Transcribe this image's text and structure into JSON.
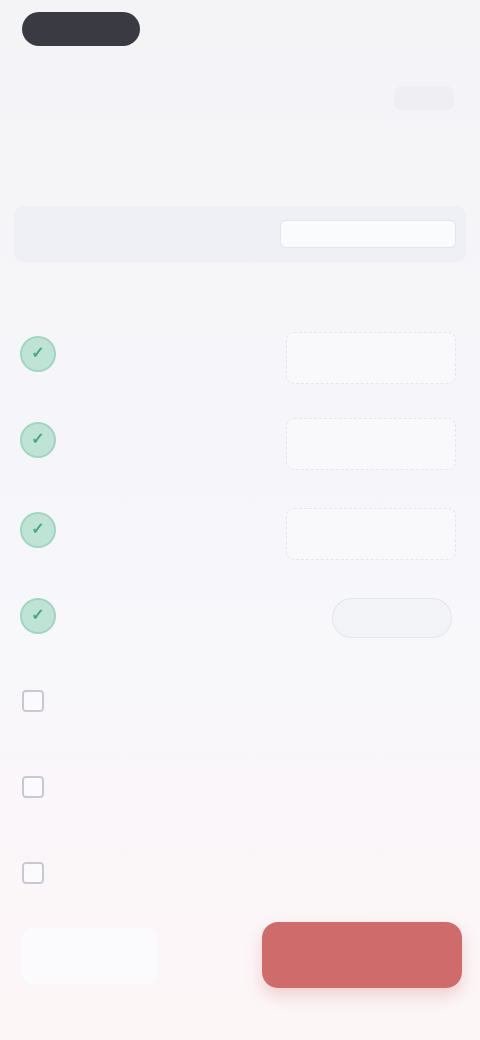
{
  "status": {
    "right_text": "",
    "pill": "status-pill"
  },
  "topbar": {
    "title": "",
    "action": ""
  },
  "section": {
    "label": ""
  },
  "search": {
    "label": "",
    "value": "",
    "placeholder": ""
  },
  "subtext": "",
  "steps": [
    {
      "label": "",
      "meta_1": "",
      "meta_2": "",
      "button": ""
    },
    {
      "label": "",
      "meta_1": "",
      "meta_2": "",
      "button": ""
    },
    {
      "label": "",
      "meta_1": "",
      "meta_2": "",
      "button": ""
    },
    {
      "label": "",
      "meta_1": "",
      "meta_2": "",
      "button": ""
    }
  ],
  "checks": [
    {
      "label": ""
    },
    {
      "label": ""
    },
    {
      "label": ""
    }
  ],
  "footer": {
    "secondary": "",
    "primary": ""
  },
  "colors": {
    "accent_success": "#bfe4d5",
    "accent_primary": "#cf6b6b"
  }
}
